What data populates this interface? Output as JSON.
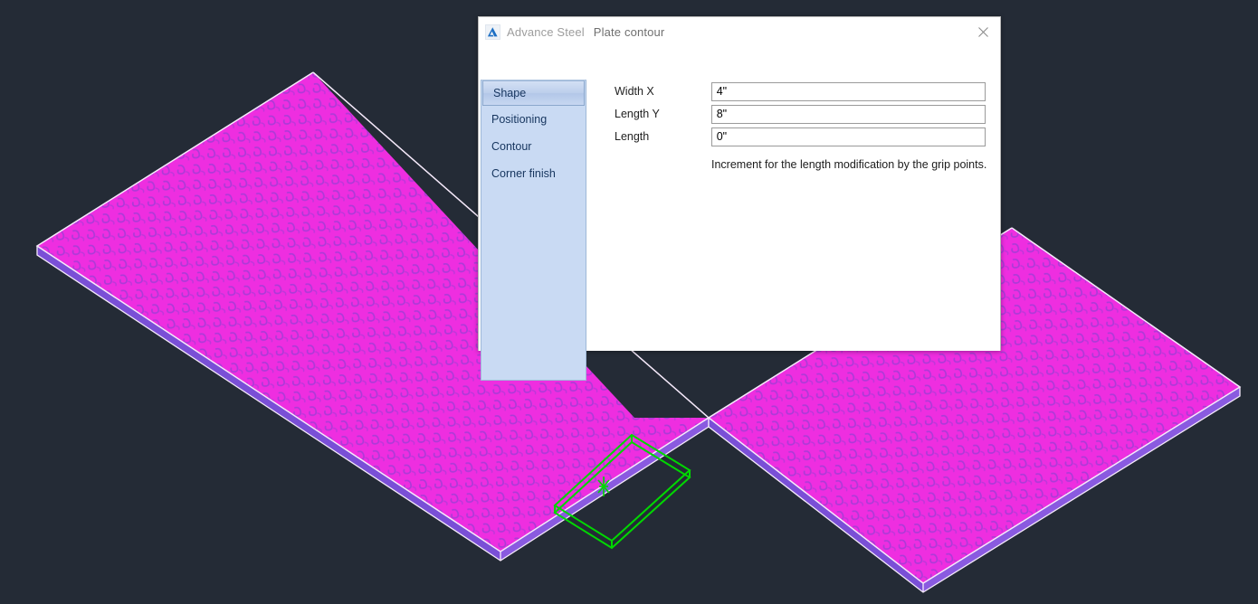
{
  "viewport": {
    "name": "3d-model-viewport",
    "background_color": "#242b36",
    "plate_fill_color": "#ee2ee0",
    "plate_hatch_color": "#9b3bd2",
    "plate_edge_color": "#7a4fd6",
    "plate_outline_color": "#f2e6f8",
    "new_contour_color": "#00d400",
    "objects": [
      {
        "name": "plate-left",
        "type": "steel-plate",
        "selected": false
      },
      {
        "name": "plate-right",
        "type": "steel-plate",
        "selected": false
      },
      {
        "name": "plate-contour-preview",
        "type": "contour-wireframe",
        "selected": true
      },
      {
        "name": "ucs-grip-marker",
        "type": "marker"
      }
    ]
  },
  "dialog": {
    "app_icon": "autodesk-a-icon",
    "app_name": "Advance Steel",
    "title": "Plate contour",
    "close_label": "✕",
    "sidebar": {
      "items": [
        {
          "label": "Shape",
          "selected": true
        },
        {
          "label": "Positioning",
          "selected": false
        },
        {
          "label": "Contour",
          "selected": false
        },
        {
          "label": "Corner finish",
          "selected": false
        }
      ]
    },
    "form": {
      "fields": [
        {
          "label": "Width X",
          "value": "4\"",
          "placeholder": ""
        },
        {
          "label": "Length Y",
          "value": "8\"",
          "placeholder": ""
        },
        {
          "label": "Length",
          "value": "0\"",
          "placeholder": ""
        }
      ],
      "hint": "Increment for the length modification by the grip points."
    }
  }
}
